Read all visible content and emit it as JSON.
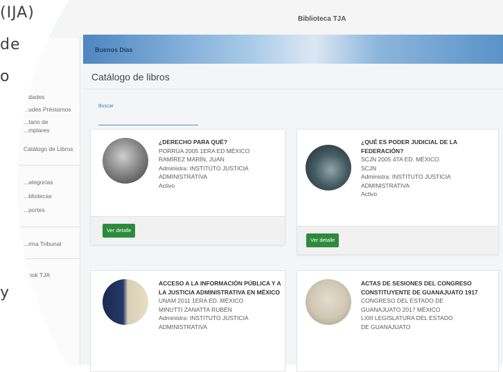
{
  "backdrop": {
    "lines": [
      "(IJA)",
      "de",
      "o",
      "y"
    ]
  },
  "topbar": {
    "brand": "Biblioteca TJA"
  },
  "sidebar": {
    "items": [
      {
        "label": "...dades"
      },
      {
        "label": "...udes Préstamos"
      },
      {
        "label": "...tario de"
      },
      {
        "label": "...mplares"
      },
      {
        "label": "Catálogo de Libros"
      },
      {
        "label": "...ategorías"
      },
      {
        "label": "...bliotecas"
      },
      {
        "label": "...portes"
      },
      {
        "label": "...rma Tribunal"
      },
      {
        "label": "...ook TJA"
      }
    ]
  },
  "banner": {
    "greeting": "Buenos Días"
  },
  "page": {
    "title": "Catálogo de libros"
  },
  "search": {
    "label": "Buscar",
    "value": "",
    "placeholder": ""
  },
  "colors": {
    "accent": "#4a8fd1",
    "button": "#2e8b3d",
    "banner": "#4e86c0"
  },
  "books": [
    {
      "title": "¿DERECHO PARA QUÉ?",
      "line1": "PORRÚA 2005 1ERA ED MÉXICO",
      "line2": "RAMÍREZ MARÍN, JUAN",
      "line3": "Administra: INSTITUTO JUSTICIA",
      "line4": "ADMINISTRATIVA",
      "status": "Activo",
      "button": "Ver detalle"
    },
    {
      "title": "¿QUÉ ES PODER JUDICIAL DE LA FEDERACIÓN?",
      "line1": "SCJN 2005 4TA ED. MÉXICO",
      "line2": "SCJN",
      "line3": "Administra: INSTITUTO JUSTICIA",
      "line4": "ADMINISTRATIVA",
      "status": "Activo",
      "button": "Ver detalle"
    },
    {
      "title": "ACCESO A LA INFORMACIÓN PÚBLICA Y A LA JUSTICIA ADMINISTRATIVA EN MÉXICO",
      "line1": "UNAM 2011 1ERA ED. MÉXICO",
      "line2": "MINUTTI ZANATTA RUBÉN",
      "line3": "Administra: INSTITUTO JUSTICIA",
      "line4": "ADMINISTRATIVA"
    },
    {
      "title": "ACTAS DE SESIONES DEL CONGRESO CONSTITUYENTE DE GUANAJUATO 1917",
      "line1": "CONGRESO DEL ESTADO DE",
      "line2": "GUANAJUATO 2017 MÉXICO",
      "line3": "LXIII LEGISLATURA DEL ESTADO",
      "line4": "DE GUANAJUATO"
    }
  ]
}
